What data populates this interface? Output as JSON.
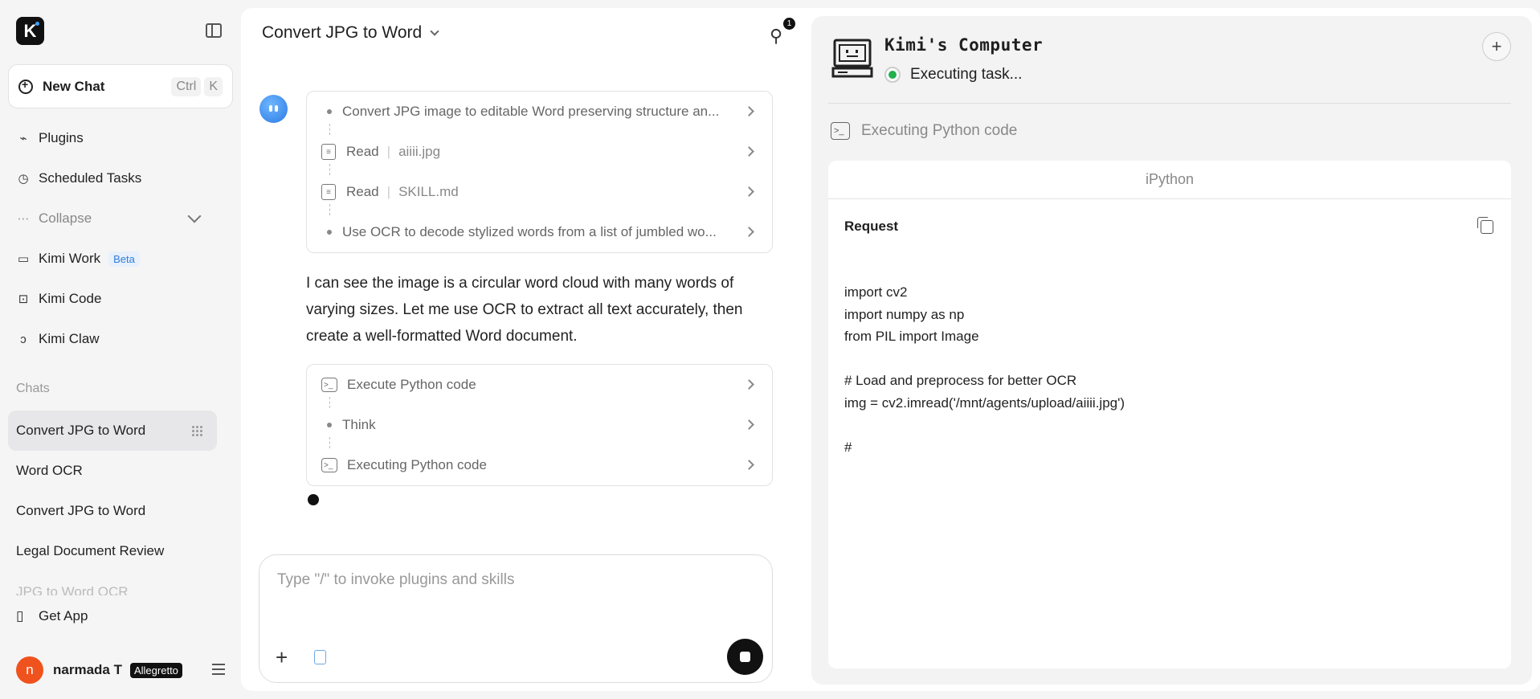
{
  "sidebar": {
    "logo_letter": "K",
    "new_chat": {
      "label": "New Chat",
      "shortcut": [
        "Ctrl",
        "K"
      ]
    },
    "nav": [
      {
        "label": "Plugins",
        "icon": "plugin-icon"
      },
      {
        "label": "Scheduled Tasks",
        "icon": "alarm-clock-icon"
      },
      {
        "label": "Collapse",
        "icon": "more-dots-icon"
      },
      {
        "label": "Kimi Work",
        "icon": "monitor-icon",
        "badge": "Beta"
      },
      {
        "label": "Kimi Code",
        "icon": "terminal-icon"
      },
      {
        "label": "Kimi Claw",
        "icon": "claw-icon"
      }
    ],
    "chats_label": "Chats",
    "chats": [
      "Convert JPG to Word",
      "Word OCR",
      "Convert JPG to Word",
      "Legal Document Review",
      "JPG to Word OCR"
    ],
    "get_app": "Get App",
    "user": {
      "initial": "n",
      "name": "narmada T",
      "plan": "Allegretto"
    }
  },
  "chat": {
    "title": "Convert JPG to Word",
    "attachment_count": "1",
    "steps_top": [
      {
        "kind": "bullet",
        "text": "Convert JPG image to editable Word preserving structure an..."
      },
      {
        "kind": "file",
        "action": "Read",
        "detail": "aiiii.jpg"
      },
      {
        "kind": "file",
        "action": "Read",
        "detail": "SKILL.md"
      },
      {
        "kind": "bullet",
        "text": "Use OCR to decode stylized words from a list of jumbled wo..."
      }
    ],
    "message": "I can see the image is a circular word cloud with many words of varying sizes. Let me use OCR to extract all text accurately, then create a well-formatted Word document.",
    "steps_bottom": [
      {
        "kind": "term",
        "text": "Execute Python code"
      },
      {
        "kind": "bullet",
        "text": "Think"
      },
      {
        "kind": "term",
        "text": "Executing Python code"
      }
    ],
    "input_placeholder": "Type \"/\" to invoke plugins and skills"
  },
  "computer": {
    "title": "Kimi's Computer",
    "status": "Executing task...",
    "status_color": "#22b14c",
    "activity": "Executing Python code",
    "tool_name": "iPython",
    "request_label": "Request",
    "code": "import cv2\nimport numpy as np\nfrom PIL import Image\n\n# Load and preprocess for better OCR\nimg = cv2.imread('/mnt/agents/upload/aiiii.jpg')\n\n#"
  }
}
